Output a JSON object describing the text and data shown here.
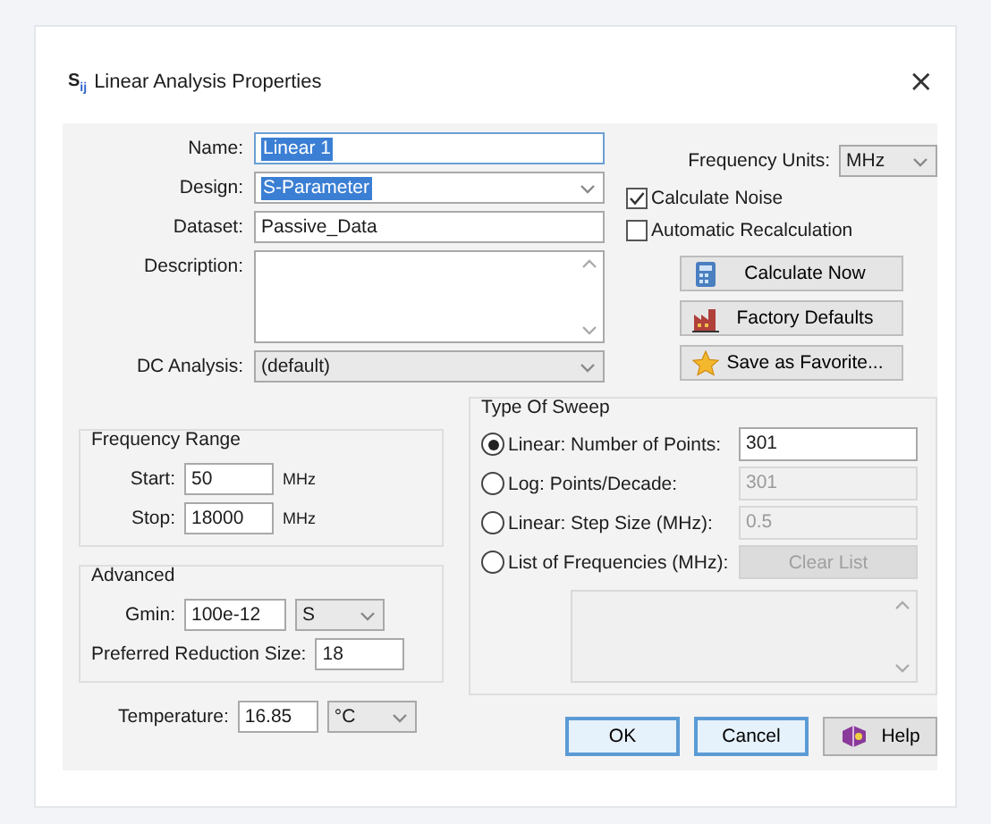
{
  "window": {
    "title_icon": "S$_{ij}$",
    "title": "Linear Analysis Properties",
    "close": "×"
  },
  "fields": [
    {
      "kind": "text",
      "label": "Name:",
      "value": "Linear 1",
      "text_selected": true,
      "focused": true
    },
    {
      "kind": "combo",
      "label": "Design:",
      "value": "S-Parameter",
      "text_selected": true,
      "focused": false
    },
    {
      "kind": "text",
      "label": "Dataset:",
      "value": "Passive_Data",
      "text_selected": false,
      "focused": false
    },
    {
      "kind": "textarea",
      "label": "Description:",
      "focused": false
    },
    {
      "kind": "dropdown",
      "label": "DC Analysis:",
      "value": "(default)",
      "focused": false
    }
  ],
  "frequency_units": {
    "label": "Frequency Units:",
    "value": "MHz"
  },
  "checkboxes": [
    {
      "label": "Calculate Noise",
      "checked": true
    },
    {
      "label": "Automatic Recalculation",
      "checked": false
    }
  ],
  "action_buttons": [
    {
      "label": "Calculate Now"
    },
    {
      "label": "Factory Defaults"
    },
    {
      "label": "Save as Favorite..."
    }
  ],
  "frequency_range": {
    "title": "Frequency Range",
    "rows": [
      {
        "label": "Start:",
        "value": "50",
        "unit": "MHz"
      },
      {
        "label": "Stop:",
        "value": "18000",
        "unit": "MHz"
      }
    ]
  },
  "advanced": {
    "title": "Advanced",
    "rows": [
      {
        "kind": "value_unit",
        "label": "Gmin:",
        "value": "100e-12",
        "unit": "S"
      },
      {
        "kind": "value",
        "label": "Preferred Reduction Size:",
        "value": "18"
      }
    ]
  },
  "temperature": {
    "label": "Temperature:",
    "value": "16.85",
    "unit": "°C"
  },
  "sweep": {
    "title": "Type Of Sweep",
    "options": [
      {
        "kind": "field",
        "label": "Linear: Number of Points:",
        "selected": true,
        "value": "301",
        "disabled": false
      },
      {
        "kind": "field",
        "label": "Log: Points/Decade:",
        "selected": false,
        "value": "301",
        "disabled": true
      },
      {
        "kind": "field",
        "label": "Linear: Step Size (MHz):",
        "selected": false,
        "value": "0.5",
        "disabled": true
      },
      {
        "kind": "button",
        "label": "List of Frequencies (MHz):",
        "selected": false,
        "value": "Clear List",
        "disabled": true
      }
    ]
  },
  "buttons": [
    {
      "label": "OK",
      "highlighted": true
    },
    {
      "label": "Cancel",
      "highlighted": true
    },
    {
      "label": "Help",
      "highlighted": false
    }
  ]
}
